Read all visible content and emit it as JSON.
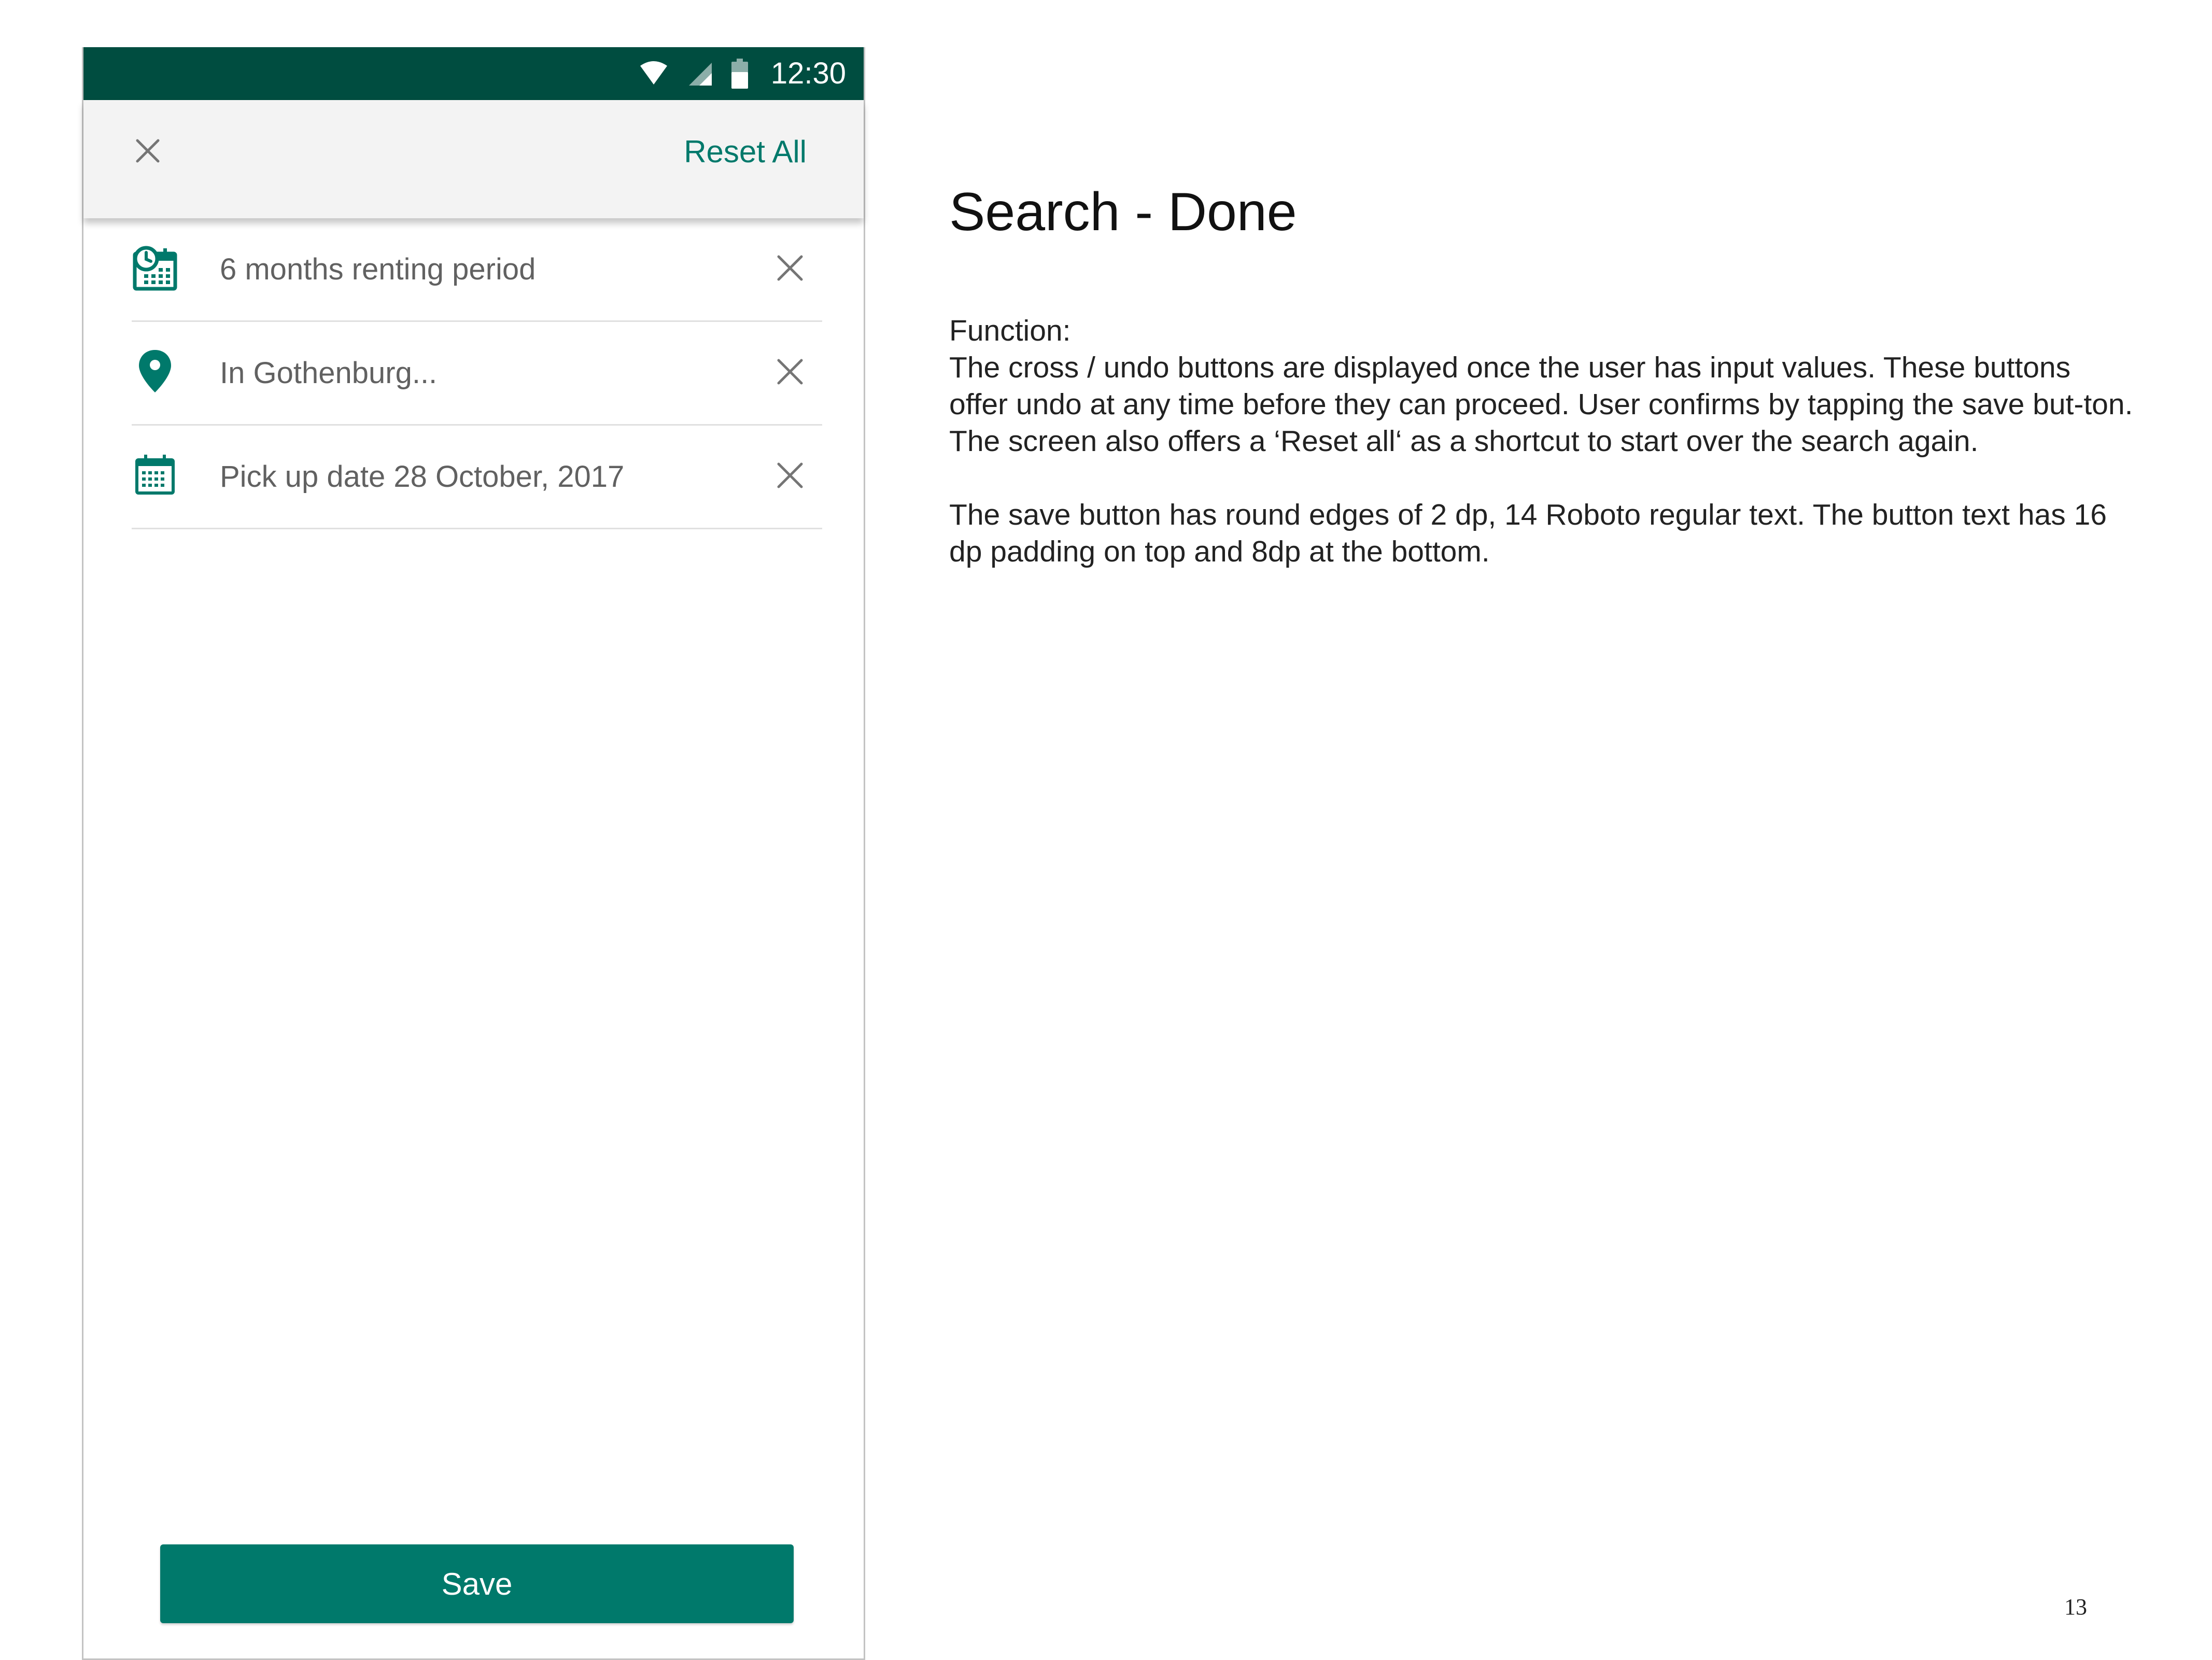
{
  "status_bar": {
    "time": "12:30",
    "icons": [
      "wifi-icon",
      "signal-icon",
      "battery-icon"
    ]
  },
  "app_bar": {
    "close_icon": "close-icon",
    "reset_label": "Reset All"
  },
  "filters": [
    {
      "icon": "rental-period-icon",
      "label": "6 months renting period",
      "clear_icon": "close-icon"
    },
    {
      "icon": "location-pin-icon",
      "label": "In Gothenburg...",
      "clear_icon": "close-icon"
    },
    {
      "icon": "calendar-icon",
      "label": "Pick up date 28 October, 2017",
      "clear_icon": "close-icon"
    }
  ],
  "save_button": {
    "label": "Save"
  },
  "doc": {
    "title": "Search - Done",
    "function_label": "Function:",
    "paragraph1": "The cross / undo buttons are displayed once the user has input values. These buttons offer undo at any time before they can proceed. User confirms by tapping the save but-ton. The screen also offers a ‘Reset all‘ as a shortcut to start over the search again.",
    "paragraph2": "The save button has round edges of 2 dp, 14 Roboto regular text. The button text has 16 dp padding on top and 8dp at the bottom.",
    "page_number": "13"
  },
  "colors": {
    "status_bar": "#004d40",
    "accent": "#00796b",
    "app_bar_bg": "#f3f3f3",
    "label_text": "#616161",
    "divider": "#e0e0e0"
  }
}
